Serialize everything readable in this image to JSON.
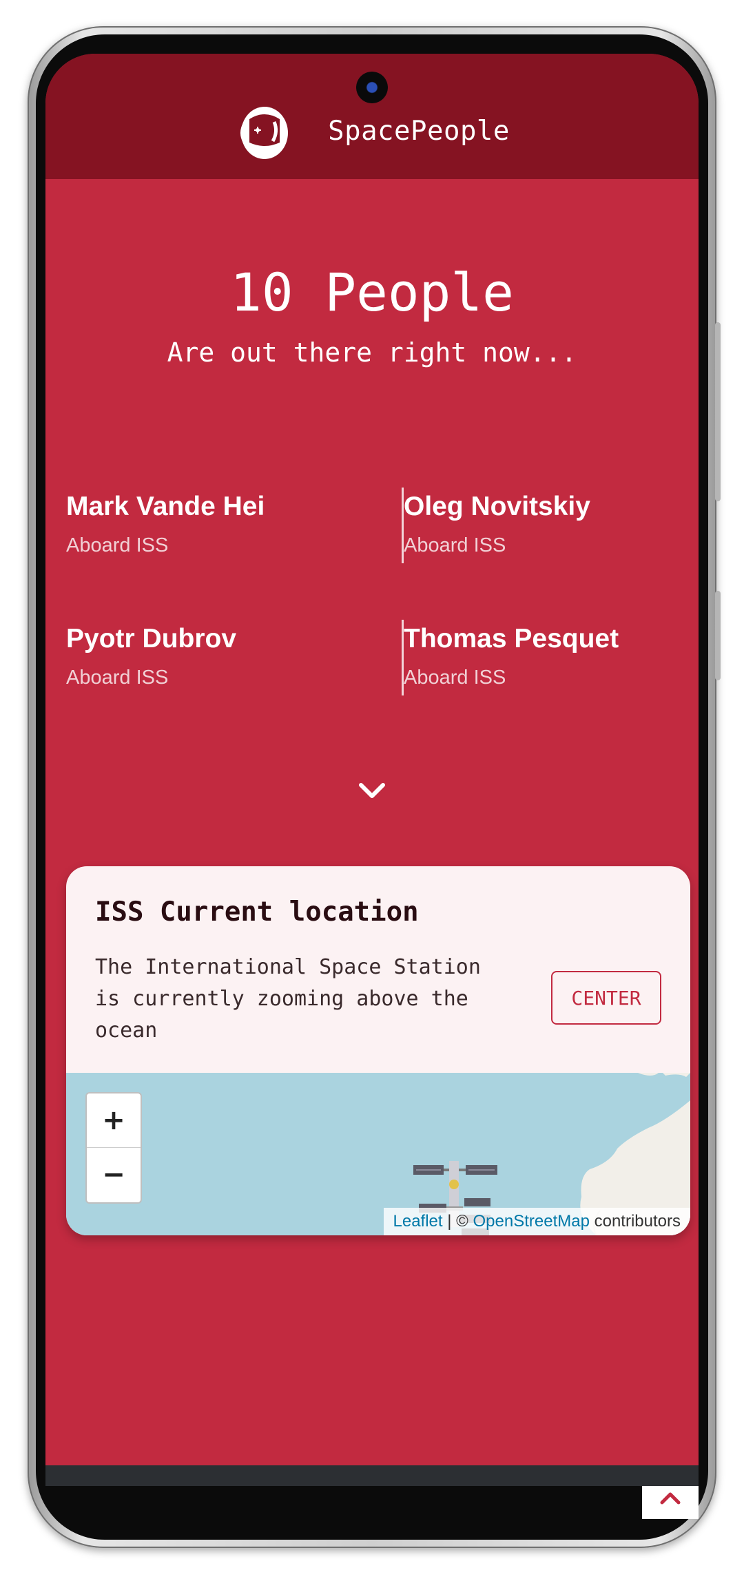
{
  "app": {
    "brand_name": "SpacePeople"
  },
  "hero": {
    "title": "10 People",
    "subtitle": "Are out there right now..."
  },
  "people": [
    {
      "name": "Mark Vande Hei",
      "location": "Aboard ISS"
    },
    {
      "name": "Oleg Novitskiy",
      "location": "Aboard ISS"
    },
    {
      "name": "Pyotr Dubrov",
      "location": "Aboard ISS"
    },
    {
      "name": "Thomas Pesquet",
      "location": "Aboard ISS"
    }
  ],
  "iss_card": {
    "title": "ISS Current location",
    "description": "The International Space Station is currently zooming above the ocean",
    "center_label": "CENTER"
  },
  "map": {
    "zoom_in_label": "+",
    "zoom_out_label": "−",
    "attribution_leaflet": "Leaflet",
    "attribution_sep": " | © ",
    "attribution_osm": "OpenStreetMap",
    "attribution_contrib": " contributors"
  },
  "colors": {
    "primary": "#c22a40",
    "header": "#851322",
    "card_bg": "#fcf2f3",
    "map_water": "#aad3df",
    "map_land": "#f2efe9"
  },
  "icons": {
    "logo": "astronaut-helmet-icon",
    "expand": "chevron-down-icon",
    "iss": "space-station-icon",
    "to_top": "chevron-up-icon"
  }
}
